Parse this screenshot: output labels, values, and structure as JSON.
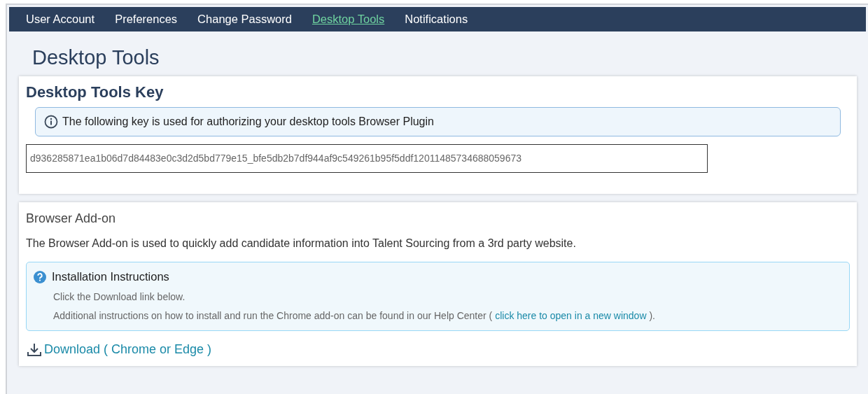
{
  "nav": [
    {
      "label": "User Account",
      "selected": false
    },
    {
      "label": "Preferences",
      "selected": false
    },
    {
      "label": "Change Password",
      "selected": false
    },
    {
      "label": "Desktop Tools",
      "selected": true
    },
    {
      "label": "Notifications",
      "selected": false
    }
  ],
  "page_title": "Desktop Tools",
  "key_card": {
    "title": "Desktop Tools Key",
    "info": "The following key is used for authorizing your desktop tools Browser Plugin",
    "key_value": "d936285871ea1b06d7d84483e0c3d2d5bd779e15_bfe5db2b7df944af9c549261b95f5ddf12011485734688059673"
  },
  "addon_card": {
    "title": "Browser Add-on",
    "description": "The Browser Add-on is used to quickly add candidate information into Talent Sourcing from a 3rd party website.",
    "instructions": {
      "title": "Installation Instructions",
      "step": "Click the Download link below.",
      "help_before": "Additional instructions on how to install and run the Chrome add-on can be found in our Help Center (",
      "help_link": "click here to open in a new window",
      "help_after": ")."
    },
    "download_link": "Download ( Chrome or Edge )"
  }
}
